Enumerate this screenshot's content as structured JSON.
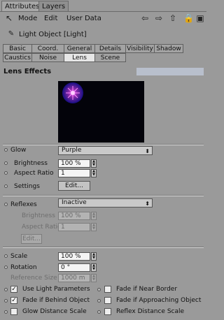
{
  "tabs": [
    "Attributes",
    "Layers"
  ],
  "menu": [
    "Mode",
    "Edit",
    "User Data"
  ],
  "object_title": "Light Object [Light]",
  "attr_tabs_row1": [
    "Basic",
    "Coord.",
    "General",
    "Details",
    "Visibility",
    "Shadow"
  ],
  "attr_tabs_row2": [
    "Caustics",
    "Noise",
    "Lens",
    "Scene"
  ],
  "section_title": "Lens Effects",
  "glow": {
    "label": "Glow",
    "value": "Purple",
    "brightness_label": "Brightness",
    "brightness_value": "100 %",
    "aspect_label": "Aspect Ratio",
    "aspect_value": "1",
    "settings_label": "Settings",
    "edit_label": "Edit..."
  },
  "reflexes": {
    "label": "Reflexes",
    "value": "Inactive",
    "brightness_label": "Brightness",
    "brightness_value": "100 %",
    "aspect_label": "Aspect Ratio",
    "aspect_value": "1",
    "edit_label": "Edit..."
  },
  "params": {
    "scale_label": "Scale",
    "scale_value": "100 %",
    "rotation_label": "Rotation",
    "rotation_value": "0 °",
    "refsize_label": "Reference Size",
    "refsize_value": "1000 m"
  },
  "checkboxes": [
    {
      "label": "Use Light Parameters",
      "checked": true
    },
    {
      "label": "Fade if Behind Object",
      "checked": true
    },
    {
      "label": "Glow Distance Scale",
      "checked": false
    },
    {
      "label": "Fade if Near Border",
      "checked": false
    },
    {
      "label": "Fade if Approaching Object",
      "checked": false
    },
    {
      "label": "Reflex Distance Scale",
      "checked": false
    }
  ]
}
